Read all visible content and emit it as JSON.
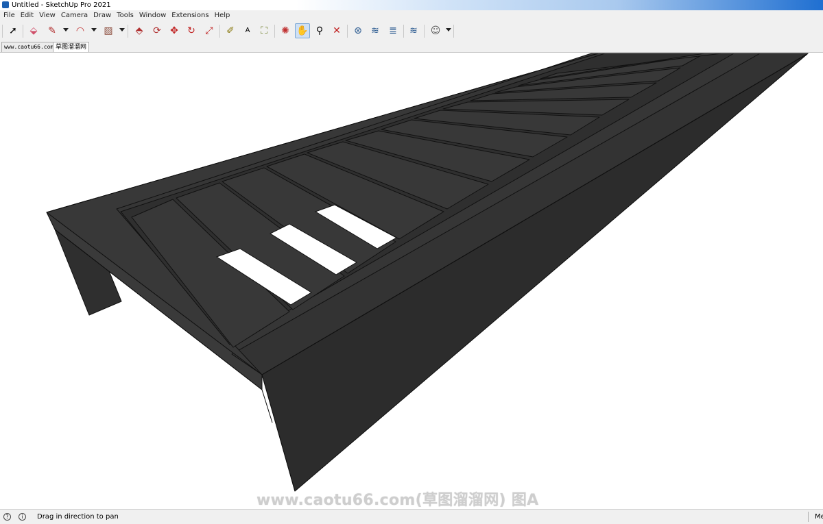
{
  "window": {
    "title": "Untitled - SketchUp Pro 2021"
  },
  "menu": [
    "File",
    "Edit",
    "View",
    "Camera",
    "Draw",
    "Tools",
    "Window",
    "Extensions",
    "Help"
  ],
  "toolbar": {
    "tools": [
      {
        "name": "select-icon",
        "glyph": "➚"
      },
      {
        "name": "eraser-icon",
        "glyph": "⬙"
      },
      {
        "name": "pencil-icon",
        "glyph": "✎"
      },
      {
        "name": "arc-icon",
        "glyph": "◠"
      },
      {
        "name": "rectangle-icon",
        "glyph": "▧"
      },
      {
        "name": "push-pull-icon",
        "glyph": "⬘"
      },
      {
        "name": "follow-me-icon",
        "glyph": "⟳"
      },
      {
        "name": "move-icon",
        "glyph": "✥"
      },
      {
        "name": "rotate-icon",
        "glyph": "↻"
      },
      {
        "name": "scale-icon",
        "glyph": "⤢"
      },
      {
        "name": "tape-measure-icon",
        "glyph": "✐"
      },
      {
        "name": "text-icon",
        "glyph": "A"
      },
      {
        "name": "paint-bucket-icon",
        "glyph": "⛶"
      },
      {
        "name": "orbit-icon",
        "glyph": "✺"
      },
      {
        "name": "pan-icon",
        "glyph": "✋"
      },
      {
        "name": "zoom-icon",
        "glyph": "⚲"
      },
      {
        "name": "zoom-extents-icon",
        "glyph": "✕"
      },
      {
        "name": "warehouse-icon",
        "glyph": "⊛"
      },
      {
        "name": "extension-warehouse-icon",
        "glyph": "≋"
      },
      {
        "name": "layout-icon",
        "glyph": "≣"
      },
      {
        "name": "extension-manager-icon",
        "glyph": "≋"
      },
      {
        "name": "account-icon",
        "glyph": "☺"
      }
    ]
  },
  "scene_tabs": [
    "www.caotu66.com",
    "草图溜溜网"
  ],
  "watermark": "www.caotu66.com(草图溜溜网) 图A",
  "status": {
    "message": "Drag in direction to pan",
    "measurements": "Me"
  },
  "colors": {
    "model_fill": "#353535",
    "model_edge": "#111111",
    "active_tool": "#cfe0f3"
  }
}
